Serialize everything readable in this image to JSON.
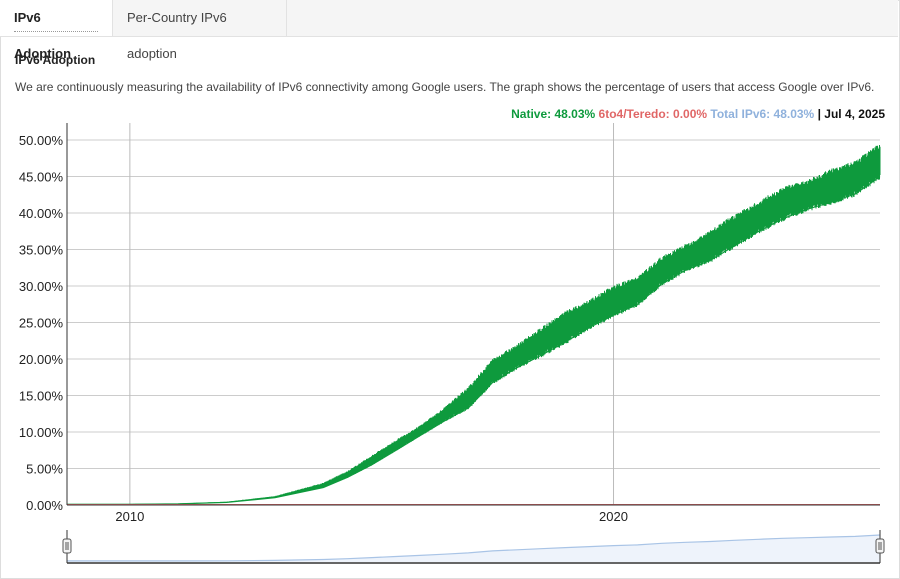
{
  "tabs": [
    {
      "label": "IPv6 Adoption",
      "active": true
    },
    {
      "label": "Per-Country IPv6 adoption",
      "active": false
    }
  ],
  "section_title": "IPv6 Adoption",
  "description": "We are continuously measuring the availability of IPv6 connectivity among Google users. The graph shows the percentage of users that access Google over IPv6.",
  "legend": {
    "native_label": "Native:",
    "native_value": "48.03%",
    "teredo_label": "6to4/Teredo:",
    "teredo_value": "0.00%",
    "total_label": "Total IPv6:",
    "total_value": "48.03%",
    "separator": "|",
    "date": "Jul 4, 2025"
  },
  "colors": {
    "native": "#0e9a3d",
    "teredo": "#e06666",
    "total": "#8fb1dc",
    "grid": "#cccccc",
    "navigator_fill": "#eef3fb",
    "navigator_line": "#a9c4e6"
  },
  "chart_data": {
    "type": "area",
    "title": "",
    "xlabel": "",
    "ylabel": "",
    "ylim": [
      0,
      50
    ],
    "y_ticks": [
      "0.00%",
      "5.00%",
      "10.00%",
      "15.00%",
      "20.00%",
      "25.00%",
      "30.00%",
      "35.00%",
      "40.00%",
      "45.00%",
      "50.00%"
    ],
    "y_tick_values": [
      0,
      5,
      10,
      15,
      20,
      25,
      30,
      35,
      40,
      45,
      50
    ],
    "x_ticks": [
      "2010",
      "2020"
    ],
    "x_tick_values": [
      2010,
      2020
    ],
    "x_range": [
      2008.7,
      2025.51
    ],
    "grid": true,
    "legend_position": "top-right",
    "series": [
      {
        "name": "Native",
        "x": [
          2008.7,
          2009.5,
          2010.0,
          2011.0,
          2012.0,
          2013.0,
          2014.0,
          2014.5,
          2015.0,
          2015.5,
          2016.0,
          2016.5,
          2017.0,
          2017.5,
          2018.0,
          2018.5,
          2019.0,
          2019.5,
          2020.0,
          2020.5,
          2021.0,
          2021.5,
          2022.0,
          2022.5,
          2023.0,
          2023.5,
          2024.0,
          2024.5,
          2025.0,
          2025.51
        ],
        "y_low": [
          0.1,
          0.1,
          0.1,
          0.15,
          0.35,
          1.0,
          2.4,
          3.8,
          5.5,
          7.5,
          9.5,
          11.5,
          13.3,
          16.8,
          18.8,
          20.5,
          22.3,
          24.3,
          26.0,
          27.5,
          30.3,
          32.2,
          33.5,
          35.5,
          37.5,
          39.2,
          40.5,
          41.5,
          42.6,
          45.0
        ],
        "y_high": [
          0.1,
          0.1,
          0.15,
          0.2,
          0.45,
          1.2,
          3.0,
          4.6,
          6.7,
          8.8,
          10.8,
          13.2,
          16.0,
          19.8,
          21.8,
          24.0,
          26.2,
          27.8,
          29.8,
          31.0,
          33.8,
          35.5,
          37.3,
          39.5,
          41.3,
          43.3,
          44.2,
          45.7,
          46.8,
          49.2
        ]
      },
      {
        "name": "6to4/Teredo",
        "x": [
          2008.7,
          2025.51
        ],
        "y": [
          0.0,
          0.0
        ]
      }
    ]
  }
}
